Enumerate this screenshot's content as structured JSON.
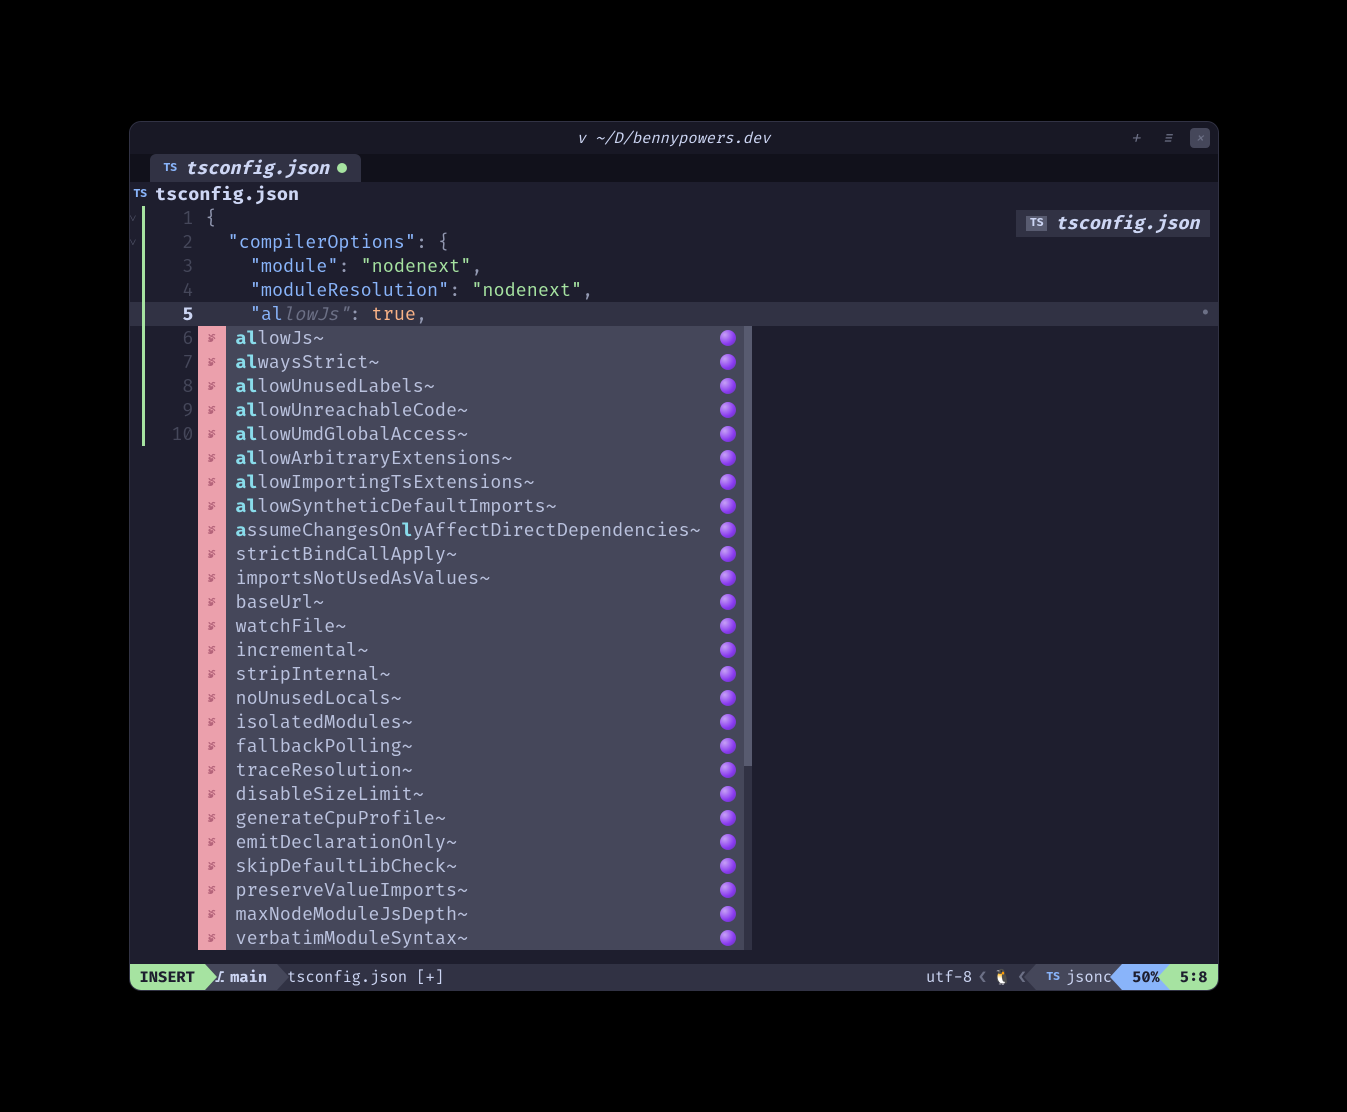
{
  "titlebar": {
    "title": "v ~/D/bennypowers.dev"
  },
  "tab": {
    "icon": "TS",
    "filename": "tsconfig.json"
  },
  "filebar": {
    "icon": "TS",
    "filename": "tsconfig.json"
  },
  "winbar": {
    "icon": "TS",
    "filename": "tsconfig.json"
  },
  "code": {
    "lines": [
      {
        "n": 1,
        "fold": "˅",
        "content": [
          {
            "t": "punc",
            "v": "{"
          }
        ]
      },
      {
        "n": 2,
        "fold": "˅",
        "content": [
          {
            "t": "",
            "v": "  "
          },
          {
            "t": "key",
            "v": "\"compilerOptions\""
          },
          {
            "t": "punc",
            "v": ": {"
          }
        ]
      },
      {
        "n": 3,
        "content": [
          {
            "t": "",
            "v": "    "
          },
          {
            "t": "key",
            "v": "\"module\""
          },
          {
            "t": "punc",
            "v": ": "
          },
          {
            "t": "str",
            "v": "\"nodenext\""
          },
          {
            "t": "punc",
            "v": ","
          }
        ]
      },
      {
        "n": 4,
        "content": [
          {
            "t": "",
            "v": "    "
          },
          {
            "t": "key",
            "v": "\"moduleResolution\""
          },
          {
            "t": "punc",
            "v": ": "
          },
          {
            "t": "str",
            "v": "\"nodenext\""
          },
          {
            "t": "punc",
            "v": ","
          }
        ]
      },
      {
        "n": 5,
        "current": true,
        "content": [
          {
            "t": "",
            "v": "    "
          },
          {
            "t": "key",
            "v": "\"al"
          },
          {
            "t": "ghost",
            "v": "lowJs\""
          },
          {
            "t": "punc",
            "v": ": "
          },
          {
            "t": "bool",
            "v": "true"
          },
          {
            "t": "punc",
            "v": ","
          }
        ]
      },
      {
        "n": 6,
        "content": []
      },
      {
        "n": 7,
        "content": []
      },
      {
        "n": 8,
        "content": []
      },
      {
        "n": 9,
        "content": []
      },
      {
        "n": 10,
        "content": []
      }
    ]
  },
  "completions": [
    {
      "prefix": "al",
      "rest": "lowJs~"
    },
    {
      "prefix": "al",
      "rest": "waysStrict~"
    },
    {
      "prefix": "al",
      "rest": "lowUnusedLabels~"
    },
    {
      "prefix": "al",
      "rest": "lowUnreachableCode~"
    },
    {
      "prefix": "al",
      "rest": "lowUmdGlobalAccess~"
    },
    {
      "prefix": "al",
      "rest": "lowArbitraryExtensions~"
    },
    {
      "prefix": "al",
      "rest": "lowImportingTsExtensions~"
    },
    {
      "prefix": "al",
      "rest": "lowSyntheticDefaultImports~"
    },
    {
      "prefix": "a",
      "mid": "ssumeChangesOn",
      "hl2": "l",
      "rest": "yAffectDirectDependencies~"
    },
    {
      "prefix": "",
      "rest": "strictBindCallApply~"
    },
    {
      "prefix": "",
      "rest": "importsNotUsedAsValues~"
    },
    {
      "prefix": "",
      "rest": "baseUrl~"
    },
    {
      "prefix": "",
      "rest": "watchFile~"
    },
    {
      "prefix": "",
      "rest": "incremental~"
    },
    {
      "prefix": "",
      "rest": "stripInternal~"
    },
    {
      "prefix": "",
      "rest": "noUnusedLocals~"
    },
    {
      "prefix": "",
      "rest": "isolatedModules~"
    },
    {
      "prefix": "",
      "rest": "fallbackPolling~"
    },
    {
      "prefix": "",
      "rest": "traceResolution~"
    },
    {
      "prefix": "",
      "rest": "disableSizeLimit~"
    },
    {
      "prefix": "",
      "rest": "generateCpuProfile~"
    },
    {
      "prefix": "",
      "rest": "emitDeclarationOnly~"
    },
    {
      "prefix": "",
      "rest": "skipDefaultLibCheck~"
    },
    {
      "prefix": "",
      "rest": "preserveValueImports~"
    },
    {
      "prefix": "",
      "rest": "maxNodeModuleJsDepth~"
    },
    {
      "prefix": "",
      "rest": "verbatimModuleSyntax~"
    }
  ],
  "statusline": {
    "mode": "INSERT",
    "branch_icon": "⎇",
    "branch": "main",
    "file": "tsconfig.json [+]",
    "encoding": "utf-8",
    "os_icon": "🐧",
    "ft_icon": "TS",
    "filetype": "jsonc",
    "percent": "50%",
    "position": "5:8"
  }
}
